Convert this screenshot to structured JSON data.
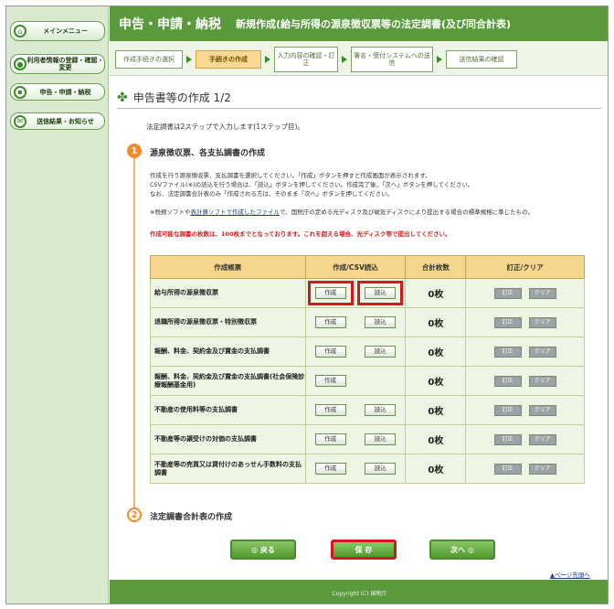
{
  "sidebar": {
    "items": [
      {
        "label": "メインメニュー"
      },
      {
        "label": "利用者情報の登録・確認・変更"
      },
      {
        "label": "申告・申請・納税"
      },
      {
        "label": "送信結果・お知らせ"
      }
    ]
  },
  "header": {
    "title": "申告・申請・納税",
    "subtitle": "新規作成(給与所得の源泉徴収票等の法定調書(及び同合計表)"
  },
  "steps": [
    {
      "label": "作成手続きの選択"
    },
    {
      "label": "手続きの作成"
    },
    {
      "label": "入力内容の確認・訂正"
    },
    {
      "label": "署名・受付システムへの送信"
    },
    {
      "label": "送信結果の確認"
    }
  ],
  "page_title": "申告書等の作成 1/2",
  "intro": "法定調書は2ステップで入力します(1ステップ目)。",
  "section1": {
    "num": "1",
    "title": "源泉徴収票、各支払調書の作成",
    "desc1": "作成を行う源泉徴収票、支払調書を選択してください。「作成」ボタンを押すと作成画面が表示されます。",
    "desc2": "CSVファイル(※)の読込を行う場合は、「読込」ボタンを押してください。作成完了後、「次へ」ボタンを押してください。",
    "desc3": "なお、法定調書合計表のみ「作成される方は、そのまま「次へ」ボタンを押してください。",
    "note_prefix": "※税務ソフトや",
    "note_link": "表計算ソフトで作成したファイル",
    "note_suffix": "で、国税庁の定める光ディスク及び磁気ディスクにより提出する場合の標準規格に準じたもの。",
    "warning": "作成可能な調書の枚数は、100枚までとなっております。これを超える場合、光ディスク等で提出してください。"
  },
  "table": {
    "headers": [
      "作成帳票",
      "作成/CSV読込",
      "合計枚数",
      "訂正/クリア"
    ],
    "create_label": "作成",
    "load_label": "読込",
    "edit_label": "訂正",
    "clear_label": "クリア",
    "rows": [
      {
        "name": "給与所得の源泉徴収票",
        "count": "0枚"
      },
      {
        "name": "退職所得の源泉徴収票・特別徴収票",
        "count": "0枚"
      },
      {
        "name": "報酬、料金、契約金及び賞金の支払調書",
        "count": "0枚"
      },
      {
        "name": "報酬、料金、契約金及び賞金の支払調書(社会保険診療報酬基金用)",
        "count": "0枚"
      },
      {
        "name": "不動産の使用料等の支払調書",
        "count": "0枚"
      },
      {
        "name": "不動産等の譲受けの対価の支払調書",
        "count": "0枚"
      },
      {
        "name": "不動産等の売買又は貸付けのあっせん手数料の支払調書",
        "count": "0枚"
      }
    ]
  },
  "section2": {
    "num": "2",
    "title": "法定調書合計表の作成"
  },
  "buttons": {
    "back": "◎ 戻る",
    "save": "保 存",
    "next": "次へ ◎"
  },
  "page_top": "▲ページ先頭へ",
  "footer": "Copyright (C) 国税庁",
  "colors": {
    "header": "#5a9a3c",
    "accent": "#f08a2a",
    "highlight": "#d6161f"
  }
}
